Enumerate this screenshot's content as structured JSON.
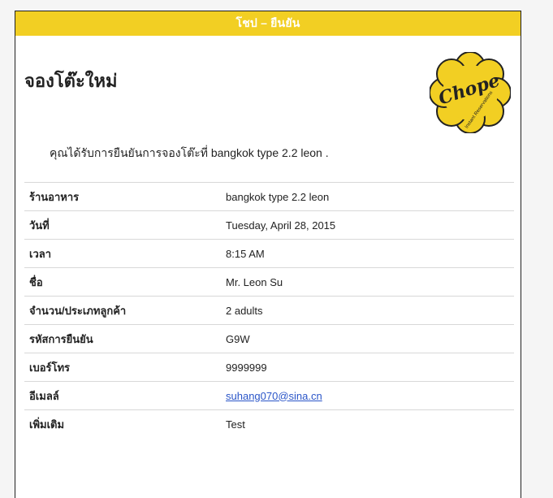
{
  "header": {
    "title": "โชป – ยืนยัน"
  },
  "page_title": "จองโต๊ะใหม่",
  "logo": {
    "text": "Chope",
    "tagline": "Instant Reservations",
    "color": "#f2cf23"
  },
  "intro": "คุณได้รับการยืนยันการจองโต๊ะที่ bangkok type 2.2 leon .",
  "details": [
    {
      "label": "ร้านอาหาร",
      "value": "bangkok type 2.2 leon"
    },
    {
      "label": "วันที่",
      "value": "Tuesday, April 28, 2015"
    },
    {
      "label": "เวลา",
      "value": "8:15 AM"
    },
    {
      "label": "ชื่อ",
      "value": "Mr. Leon Su"
    },
    {
      "label": "จำนวน/ประเภทลูกค้า",
      "value": "2 adults"
    },
    {
      "label": "รหัสการยืนยัน",
      "value": "G9W"
    },
    {
      "label": "เบอร์โทร",
      "value": "9999999"
    },
    {
      "label": "อีเมลล์",
      "value": "suhang070@sina.cn"
    },
    {
      "label": "เพิ่มเติม",
      "value": "Test"
    }
  ]
}
